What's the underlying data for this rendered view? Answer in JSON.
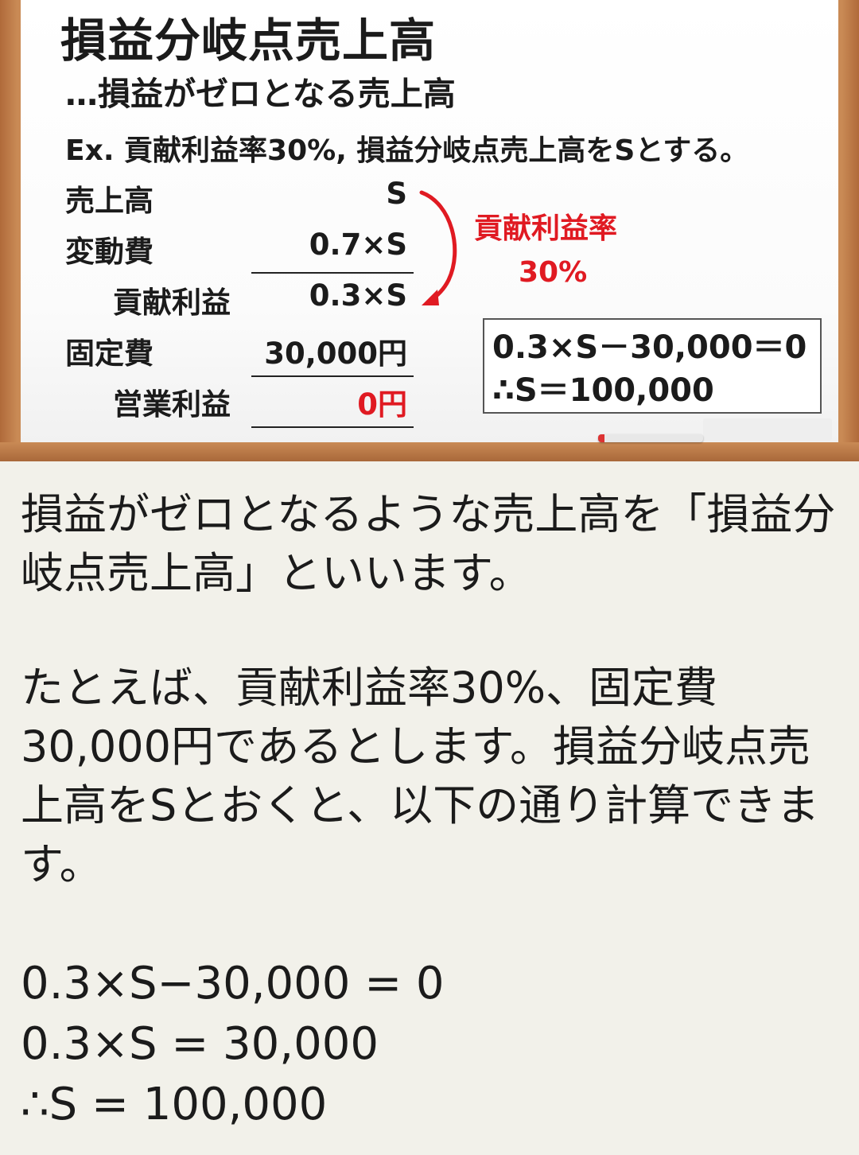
{
  "board": {
    "title": "損益分岐点売上高",
    "subtitle": "…損益がゼロとなる売上高",
    "example": "Ex. 貢献利益率30%, 損益分岐点売上高をSとする。",
    "rows": [
      {
        "label": "売上高",
        "value": "S"
      },
      {
        "label": "変動費",
        "value": "0.7×S"
      },
      {
        "label": "貢献利益",
        "value": "0.3×S"
      },
      {
        "label": "固定費",
        "value": "30,000円"
      },
      {
        "label": "営業利益",
        "value": "0円"
      }
    ],
    "ratio_label": "貢献利益率",
    "ratio_value": "30%",
    "equation_lines": [
      "0.3×S－30,000＝0",
      "∴S＝100,000"
    ],
    "accent_color": "#e01a22"
  },
  "body": {
    "paragraph1": "損益がゼロとなるような売上高を「損益分岐点売上高」といいます。",
    "paragraph2": "たとえば、貢献利益率30%、固定費30,000円であるとします。損益分岐点売上高をSとおくと、以下の通り計算できます。",
    "calc_lines": [
      "0.3×S−30,000 = 0",
      "0.3×S = 30,000",
      "∴S = 100,000"
    ]
  }
}
